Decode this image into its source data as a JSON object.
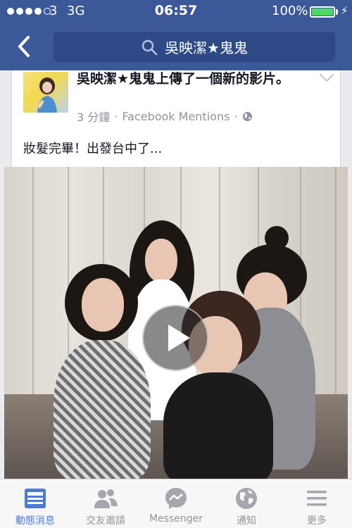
{
  "status_bar": {
    "carrier": "3",
    "network": "3G",
    "time": "06:57",
    "battery": "100%",
    "battery_level": 1.0
  },
  "header": {
    "search_text": "吳映潔★鬼鬼"
  },
  "post": {
    "headline": "吳映潔★鬼鬼上傳了一個新的影片。",
    "time_ago": "3 分鐘",
    "separator": "·",
    "source": "Facebook Mentions",
    "privacy_icon": "globe-icon",
    "caption": "妝髮完畢！出發台中了..."
  },
  "tabs": [
    {
      "label": "動態消息",
      "icon": "news-feed-icon",
      "active": true
    },
    {
      "label": "交友邀請",
      "icon": "friend-requests-icon",
      "active": false
    },
    {
      "label": "Messenger",
      "icon": "messenger-icon",
      "active": false
    },
    {
      "label": "通知",
      "icon": "notifications-globe-icon",
      "active": false
    },
    {
      "label": "更多",
      "icon": "more-menu-icon",
      "active": false
    }
  ],
  "colors": {
    "brand": "#3b5998",
    "active_tab": "#4b7bd8",
    "battery": "#4cd964"
  }
}
